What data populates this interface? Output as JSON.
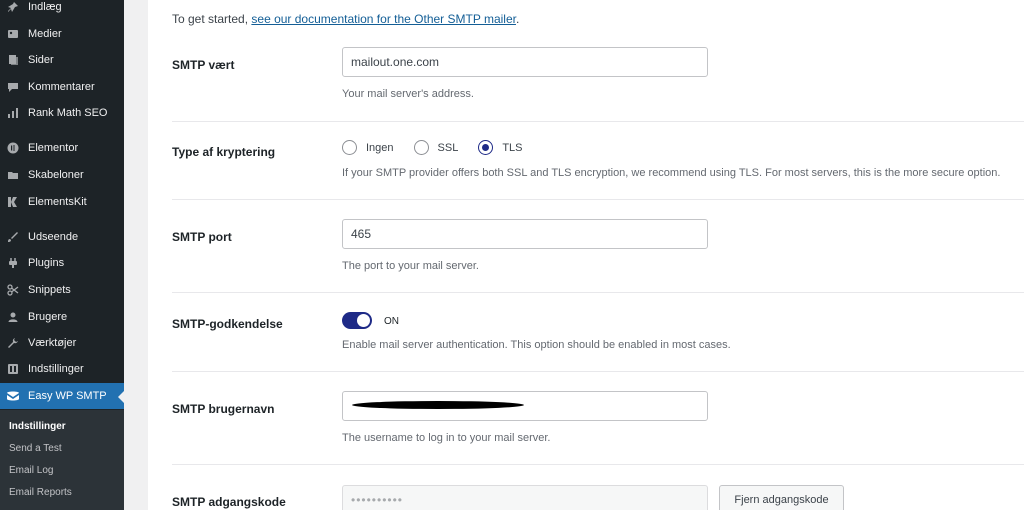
{
  "sidebar": {
    "items": [
      {
        "label": "Indlæg",
        "icon": "pin-icon"
      },
      {
        "label": "Medier",
        "icon": "media-icon"
      },
      {
        "label": "Sider",
        "icon": "pages-icon"
      },
      {
        "label": "Kommentarer",
        "icon": "comment-icon"
      },
      {
        "label": "Rank Math SEO",
        "icon": "chart-icon"
      },
      {
        "label": "Elementor",
        "icon": "elementor-icon"
      },
      {
        "label": "Skabeloner",
        "icon": "folder-icon"
      },
      {
        "label": "ElementsKit",
        "icon": "elementskit-icon"
      },
      {
        "label": "Udseende",
        "icon": "brush-icon"
      },
      {
        "label": "Plugins",
        "icon": "plugin-icon"
      },
      {
        "label": "Snippets",
        "icon": "scissors-icon"
      },
      {
        "label": "Brugere",
        "icon": "user-icon"
      },
      {
        "label": "Værktøjer",
        "icon": "wrench-icon"
      },
      {
        "label": "Indstillinger",
        "icon": "settings-icon"
      },
      {
        "label": "Easy WP SMTP",
        "icon": "mail-icon"
      }
    ],
    "submenu": [
      {
        "label": "Indstillinger"
      },
      {
        "label": "Send a Test"
      },
      {
        "label": "Email Log"
      },
      {
        "label": "Email Reports"
      }
    ]
  },
  "intro": {
    "text": "To get started, ",
    "link": "see our documentation for the Other SMTP mailer",
    "after": "."
  },
  "host": {
    "label": "SMTP vært",
    "value": "mailout.one.com",
    "desc": "Your mail server's address."
  },
  "encryption": {
    "label": "Type af kryptering",
    "options": [
      "Ingen",
      "SSL",
      "TLS"
    ],
    "selected": "TLS",
    "desc": "If your SMTP provider offers both SSL and TLS encryption, we recommend using TLS. For most servers, this is the more secure option."
  },
  "port": {
    "label": "SMTP port",
    "value": "465",
    "desc": "The port to your mail server."
  },
  "auth": {
    "label": "SMTP-godkendelse",
    "state": "ON",
    "desc": "Enable mail server authentication. This option should be enabled in most cases."
  },
  "username": {
    "label": "SMTP brugernavn",
    "desc": "The username to log in to your mail server."
  },
  "password": {
    "label": "SMTP adgangskode",
    "masked": "••••••••••",
    "button": "Fjern adgangskode"
  },
  "colors": {
    "sidebar": "#1d2327",
    "active": "#2271b1",
    "accent": "#1e2a87"
  }
}
